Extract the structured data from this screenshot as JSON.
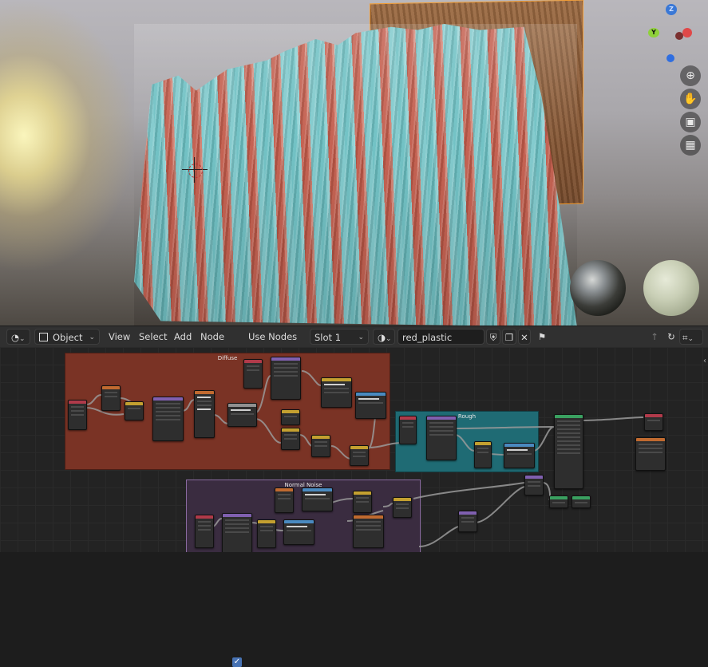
{
  "viewport": {
    "gizmo": {
      "z_label": "Z",
      "y_label": "Y"
    },
    "nav_icons": [
      "zoom-icon",
      "hand-pan-icon",
      "camera-icon",
      "grid-icon"
    ]
  },
  "toolbar": {
    "editor_type_icon": "shader-editor-icon",
    "mode": "Object",
    "menus": {
      "view": "View",
      "select": "Select",
      "add": "Add",
      "node": "Node"
    },
    "use_nodes_checked": true,
    "use_nodes_label": "Use Nodes",
    "slot": "Slot 1",
    "material_name": "red_plastic",
    "icons": {
      "fake_user": "shield-icon",
      "duplicate": "duplicate-icon",
      "unlink": "close-icon",
      "pin": "pin-icon",
      "parent": "parent-node-icon",
      "snap": "snap-icon",
      "overlay": "overlay-icon"
    }
  },
  "node_editor": {
    "frames": [
      {
        "label": "Diffuse",
        "color": "#7a3325"
      },
      {
        "label": "Rough",
        "color": "#1f6b74"
      },
      {
        "label": "Normal Noise",
        "color": "#3a2c40"
      }
    ]
  }
}
